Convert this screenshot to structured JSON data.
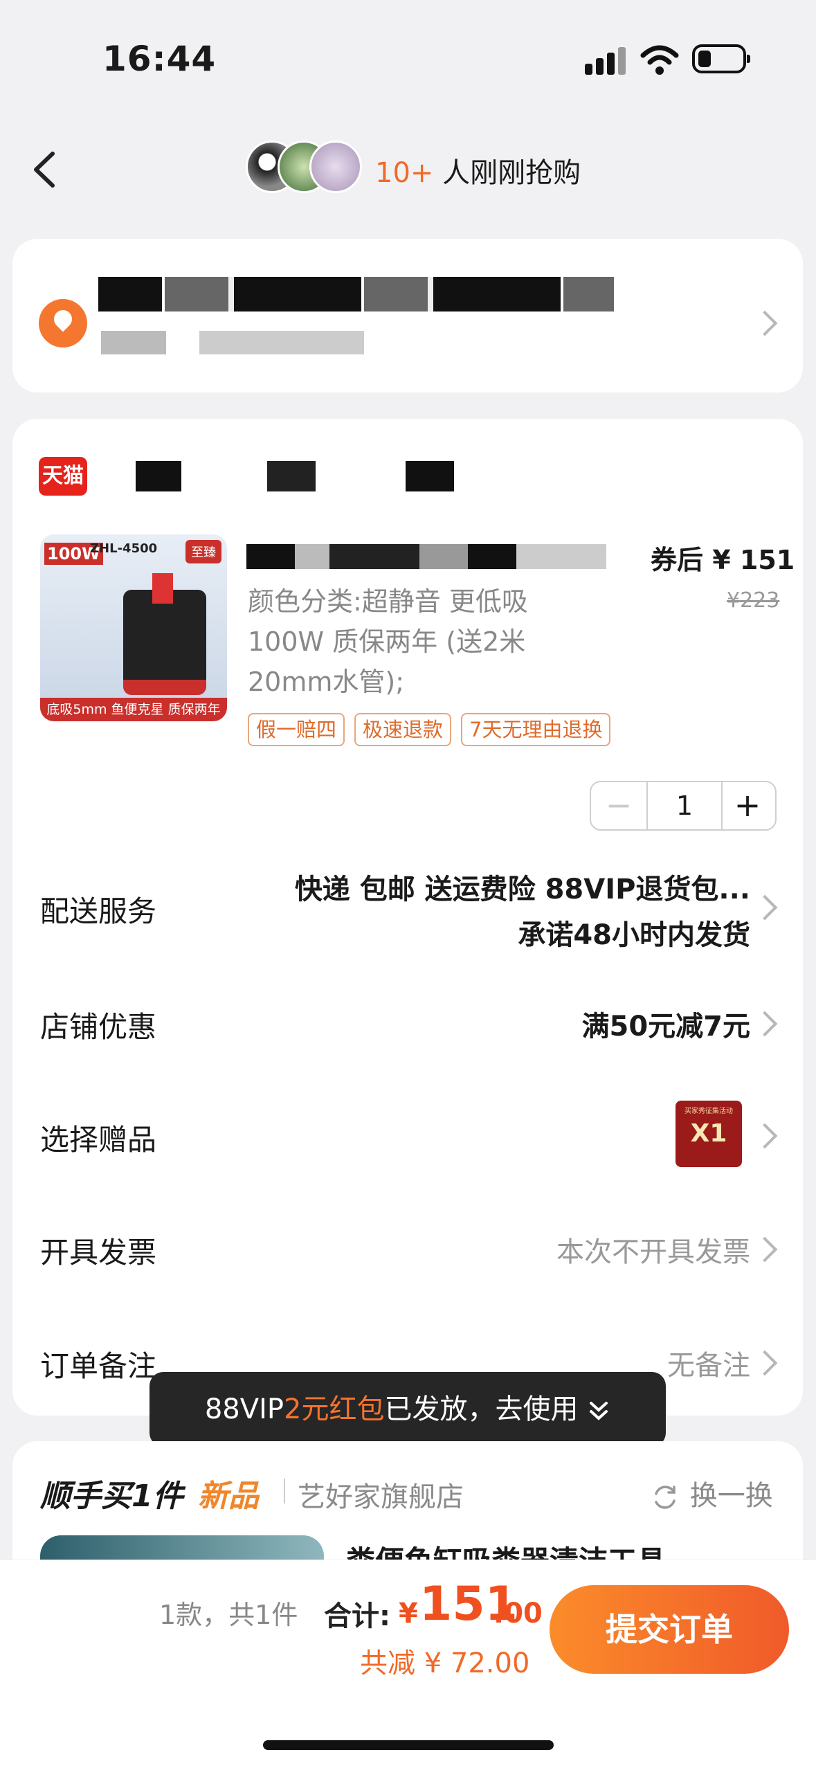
{
  "status_bar": {
    "time": "16:44"
  },
  "header": {
    "buyers_count": "10+",
    "buyers_text": "人刚刚抢购"
  },
  "address": {
    "redacted": true
  },
  "shop": {
    "platform_badge": "天猫"
  },
  "product": {
    "price_prefix": "券后",
    "price_after": "¥ 151",
    "price_original": "¥223",
    "spec": "颜色分类:超静音 更低吸 100W 质保两年 (送2米 20mm水管);",
    "image_labels": {
      "watt": "100W",
      "model": "ZHL-4500",
      "badge": "至臻",
      "bottom_text": "底吸5mm 鱼便克星 质保两年"
    },
    "tags": [
      "假一赔四",
      "极速退款",
      "7天无理由退换"
    ],
    "quantity": "1",
    "decrement_label": "−",
    "increment_label": "+"
  },
  "rows": [
    {
      "label": "配送服务",
      "value_line1": "快递 包邮 送运费险 88VIP退货包...",
      "value_line2": "承诺48小时内发货"
    },
    {
      "label": "店铺优惠",
      "value": "满50元减7元"
    },
    {
      "label": "选择赠品",
      "gift_badge": "X1"
    },
    {
      "label": "开具发票",
      "value": "本次不开具发票"
    },
    {
      "label": "订单备注",
      "value": "无备注"
    }
  ],
  "toast": {
    "prefix": "88VIP",
    "highlight": "2元红包",
    "suffix": "已发放，去使用"
  },
  "addon": {
    "title": "顺手买1件",
    "new_label": "新品",
    "shop_name": "艺好家旗舰店",
    "refresh_label": "换一换",
    "item_title": "粪便鱼缸吸粪器清洁工具"
  },
  "bottom": {
    "summary": "1款，共1件",
    "total_label": "合计:",
    "currency": "¥",
    "total_int": "151",
    "total_dec": ".00",
    "discount": "共减 ¥ 72.00",
    "submit_label": "提交订单"
  },
  "colors": {
    "accent": "#f06a28",
    "tmall_red": "#e5231b",
    "submit_start": "#fb8c2a",
    "submit_end": "#f05a2a"
  }
}
